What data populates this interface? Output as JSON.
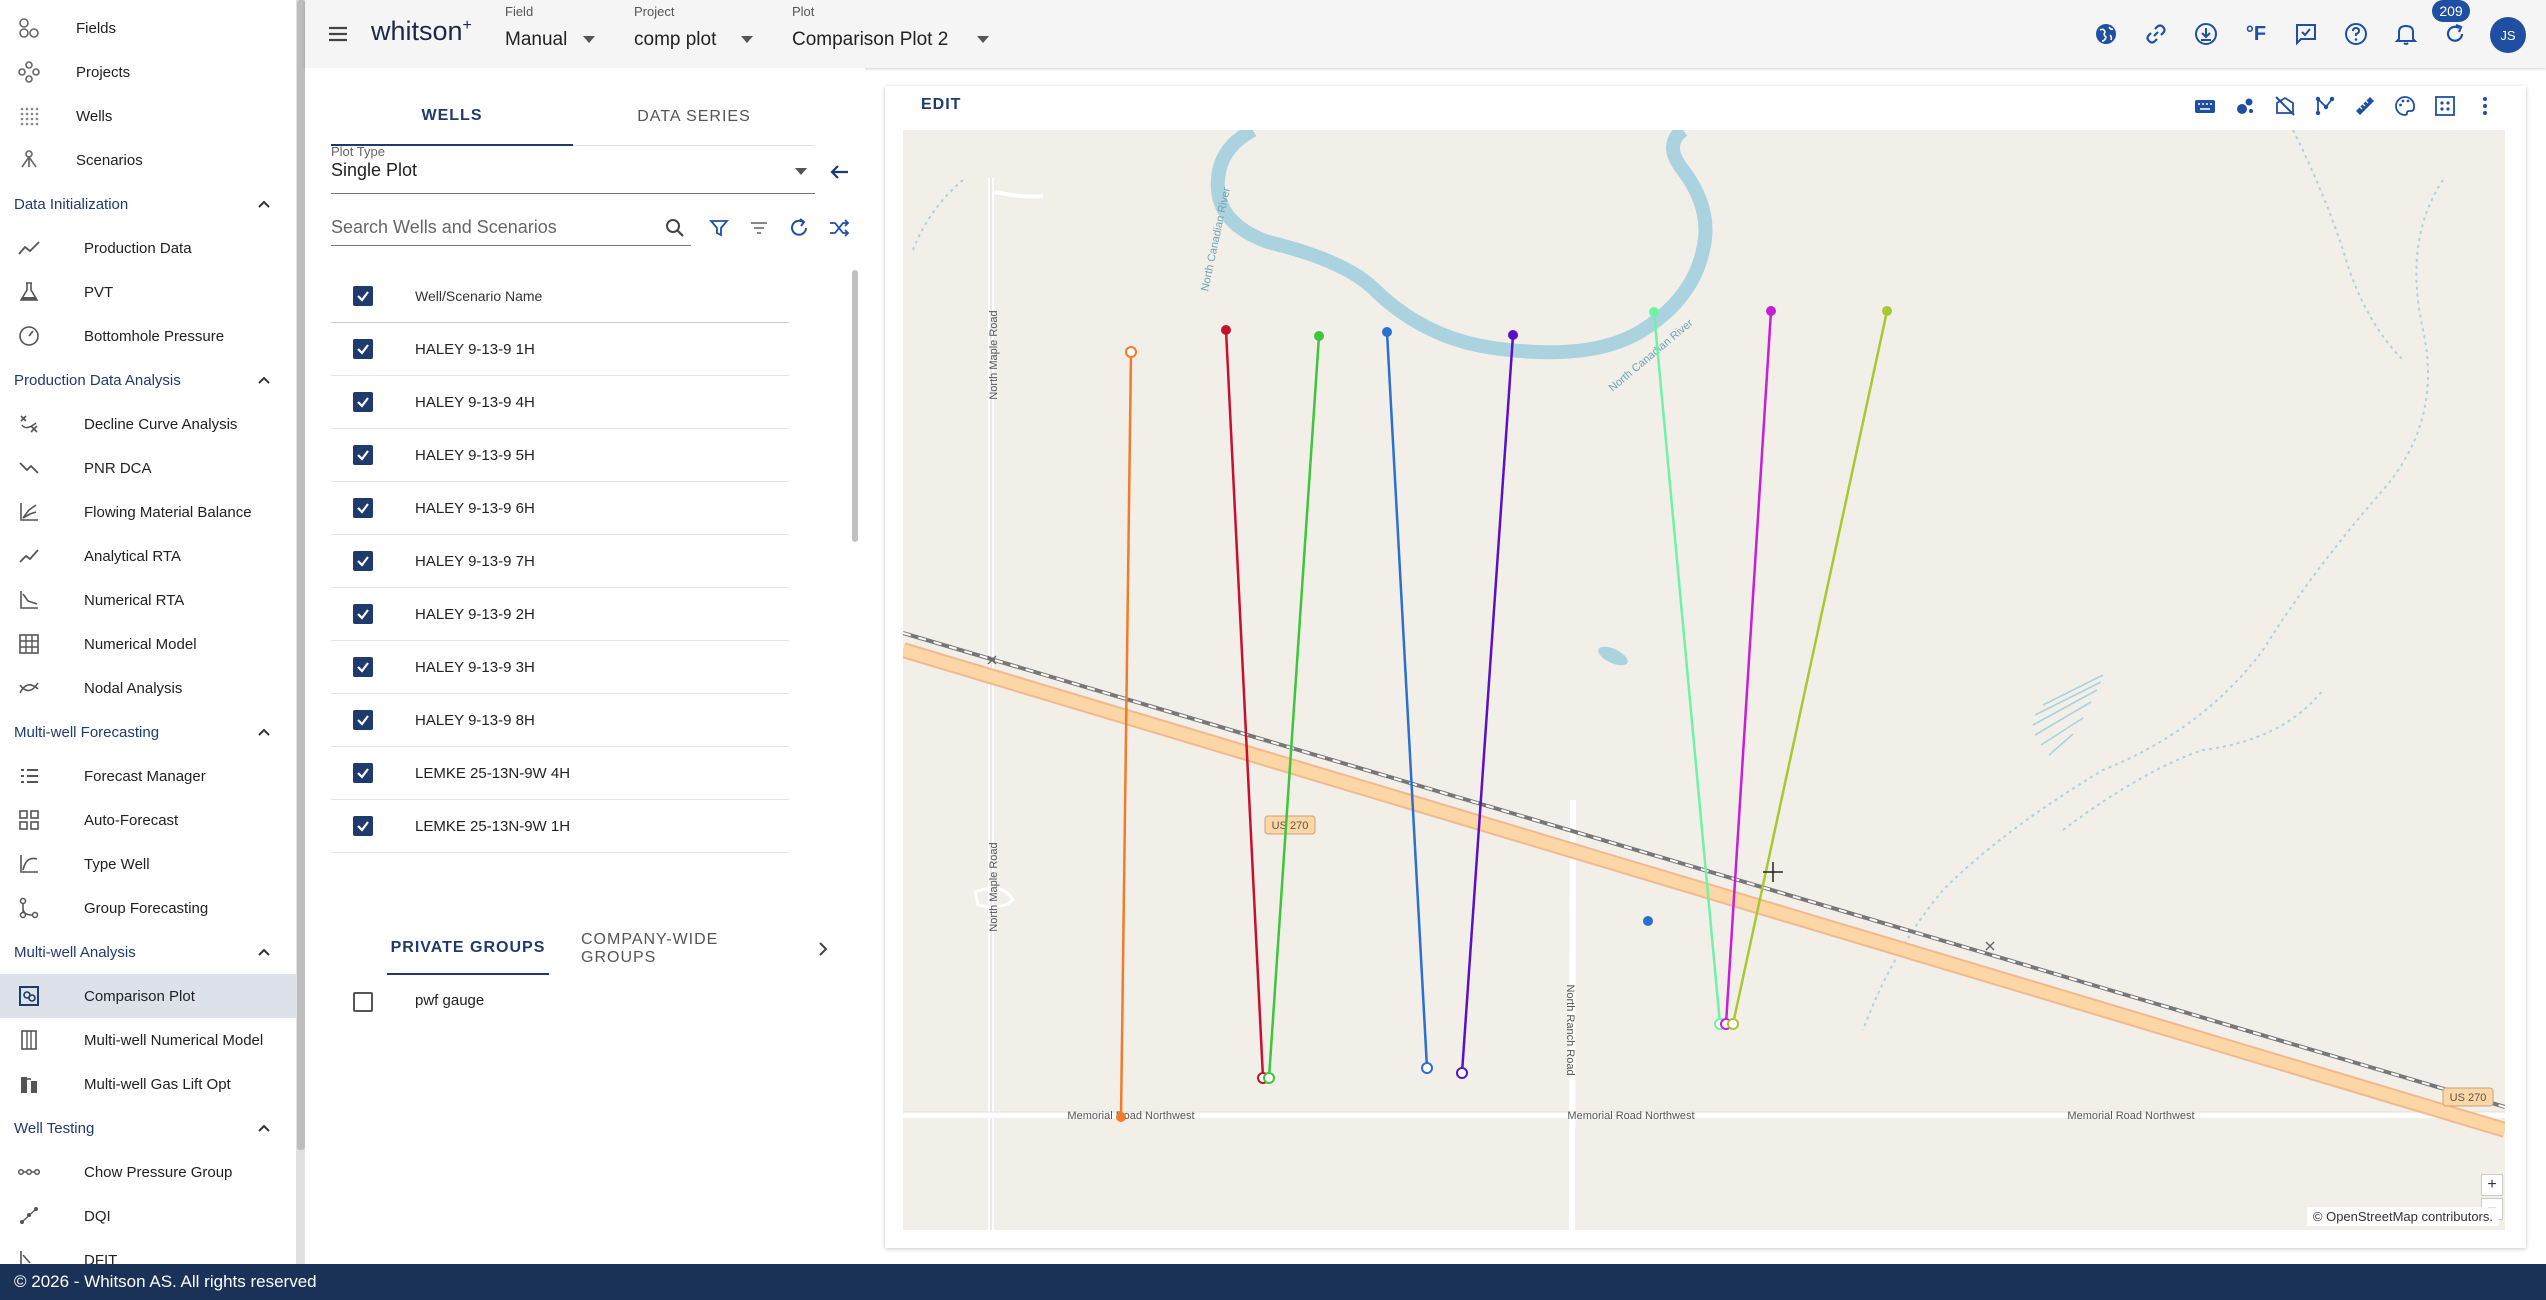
{
  "sidebar": {
    "top_items": [
      "Fields",
      "Projects",
      "Wells",
      "Scenarios"
    ],
    "sections": [
      {
        "title": "Data Initialization",
        "items": [
          "Production Data",
          "PVT",
          "Bottomhole Pressure"
        ]
      },
      {
        "title": "Production Data Analysis",
        "items": [
          "Decline Curve Analysis",
          "PNR DCA",
          "Flowing Material Balance",
          "Analytical RTA",
          "Numerical RTA",
          "Numerical Model",
          "Nodal Analysis"
        ]
      },
      {
        "title": "Multi-well Forecasting",
        "items": [
          "Forecast Manager",
          "Auto-Forecast",
          "Type Well",
          "Group Forecasting"
        ]
      },
      {
        "title": "Multi-well Analysis",
        "items": [
          "Comparison Plot",
          "Multi-well Numerical Model",
          "Multi-well Gas Lift Opt"
        ]
      },
      {
        "title": "Well Testing",
        "items": [
          "Chow Pressure Group",
          "DQI",
          "DFIT"
        ]
      }
    ],
    "active_item": "Comparison Plot"
  },
  "header": {
    "brand": "whitson",
    "brand_sup": "+",
    "field": {
      "label": "Field",
      "value": "Manual"
    },
    "project": {
      "label": "Project",
      "value": "comp plot"
    },
    "plot": {
      "label": "Plot",
      "value": "Comparison Plot 2"
    },
    "icons": [
      "globe-icon",
      "link-icon",
      "download-icon",
      "temperature-unit-icon",
      "feedback-icon",
      "help-icon",
      "notifications-icon",
      "refresh-icon"
    ],
    "temperature_unit": "°F",
    "notification_count": "209",
    "avatar_initials": "JS"
  },
  "panel": {
    "tabs": [
      "WELLS",
      "DATA SERIES"
    ],
    "plot_type_label": "Plot Type",
    "plot_type_value": "Single Plot",
    "search_placeholder": "Search Wells and Scenarios",
    "table_header": "Well/Scenario Name",
    "wells": [
      "HALEY 9-13-9 1H",
      "HALEY 9-13-9 4H",
      "HALEY 9-13-9 5H",
      "HALEY 9-13-9 6H",
      "HALEY 9-13-9 7H",
      "HALEY 9-13-9 2H",
      "HALEY 9-13-9 3H",
      "HALEY 9-13-9 8H",
      "LEMKE 25-13N-9W 4H",
      "LEMKE 25-13N-9W 1H"
    ],
    "group_tabs": [
      "PRIVATE GROUPS",
      "COMPANY-WIDE GROUPS"
    ],
    "groups": [
      "pwf gauge"
    ]
  },
  "plot": {
    "edit_label": "EDIT",
    "toolbar_icons": [
      "keyboard-icon",
      "bubble-map-icon",
      "hide-labels-icon",
      "well-paths-icon",
      "ruler-icon",
      "palette-icon",
      "reset-zoom-icon",
      "more-options-icon"
    ],
    "road_labels": {
      "us270": "US 270",
      "memorial": "Memorial Road Northwest",
      "north_maple": "North Maple Road",
      "north_ranch": "North Ranch Road",
      "canadian": "North Canadian River"
    },
    "zoom_in": "+",
    "zoom_out": "−",
    "attribution": "© OpenStreetMap contributors.",
    "well_colors": [
      "#f47a2b",
      "#c8102e",
      "#3cc63c",
      "#2b6fd1",
      "#5b10c8",
      "#6ff2a8",
      "#c81fd6",
      "#a8c832"
    ]
  },
  "footer": {
    "text": "© 2026 - Whitson AS. All rights reserved"
  }
}
